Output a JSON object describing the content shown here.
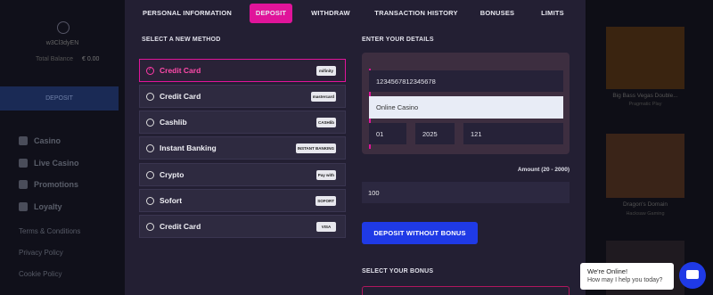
{
  "sidebar": {
    "username": "w3Cl3dyEN",
    "balance_label": "Total Balance",
    "balance_value": "€ 0.00",
    "deposit_label": "DEPOSIT",
    "nav": [
      {
        "label": "Casino",
        "icon": "spade-icon"
      },
      {
        "label": "Live Casino",
        "icon": "dice-icon"
      },
      {
        "label": "Promotions",
        "icon": "gift-icon"
      },
      {
        "label": "Loyalty",
        "icon": "star-icon"
      }
    ],
    "links": [
      "Terms & Conditions",
      "Privacy Policy",
      "Cookie Policy"
    ]
  },
  "tabs": [
    {
      "label": "PERSONAL INFORMATION"
    },
    {
      "label": "DEPOSIT",
      "active": true
    },
    {
      "label": "WITHDRAW"
    },
    {
      "label": "TRANSACTION HISTORY"
    },
    {
      "label": "BONUSES"
    },
    {
      "label": "LIMITS"
    }
  ],
  "methods_section_label": "SELECT A NEW METHOD",
  "methods": [
    {
      "label": "Credit Card",
      "logo": "mifinity",
      "selected": true
    },
    {
      "label": "Credit Card",
      "logo": "mastercard"
    },
    {
      "label": "Cashlib",
      "logo": "CASHlib"
    },
    {
      "label": "Instant Banking",
      "logo": "INSTANT BANKING"
    },
    {
      "label": "Crypto",
      "logo": "Pay with"
    },
    {
      "label": "Sofort",
      "logo": "SOFORT"
    },
    {
      "label": "Credit Card",
      "logo": "VISA"
    }
  ],
  "details_section_label": "ENTER YOUR DETAILS",
  "details": {
    "card_number": "1234567812345678",
    "card_holder": "Online Casino",
    "exp_month": "01",
    "exp_year": "2025",
    "cvv": "121"
  },
  "amount_label": "Amount (20 - 2000)",
  "amount_value": "100",
  "submit_label": "DEPOSIT WITHOUT BONUS",
  "bonus_section_label": "SELECT YOUR BONUS",
  "games": [
    {
      "title": "Big Bass Vegas Double...",
      "sub": "Pragmatic Play"
    },
    {
      "title": "Dragon's Domain",
      "sub": "Hacksaw Gaming"
    }
  ],
  "chat": {
    "line1": "We're Online!",
    "line2": "How may I help you today?"
  },
  "colors": {
    "accent": "#e0149a",
    "primary_button": "#1f3ae6",
    "modal_bg": "#231f33"
  }
}
